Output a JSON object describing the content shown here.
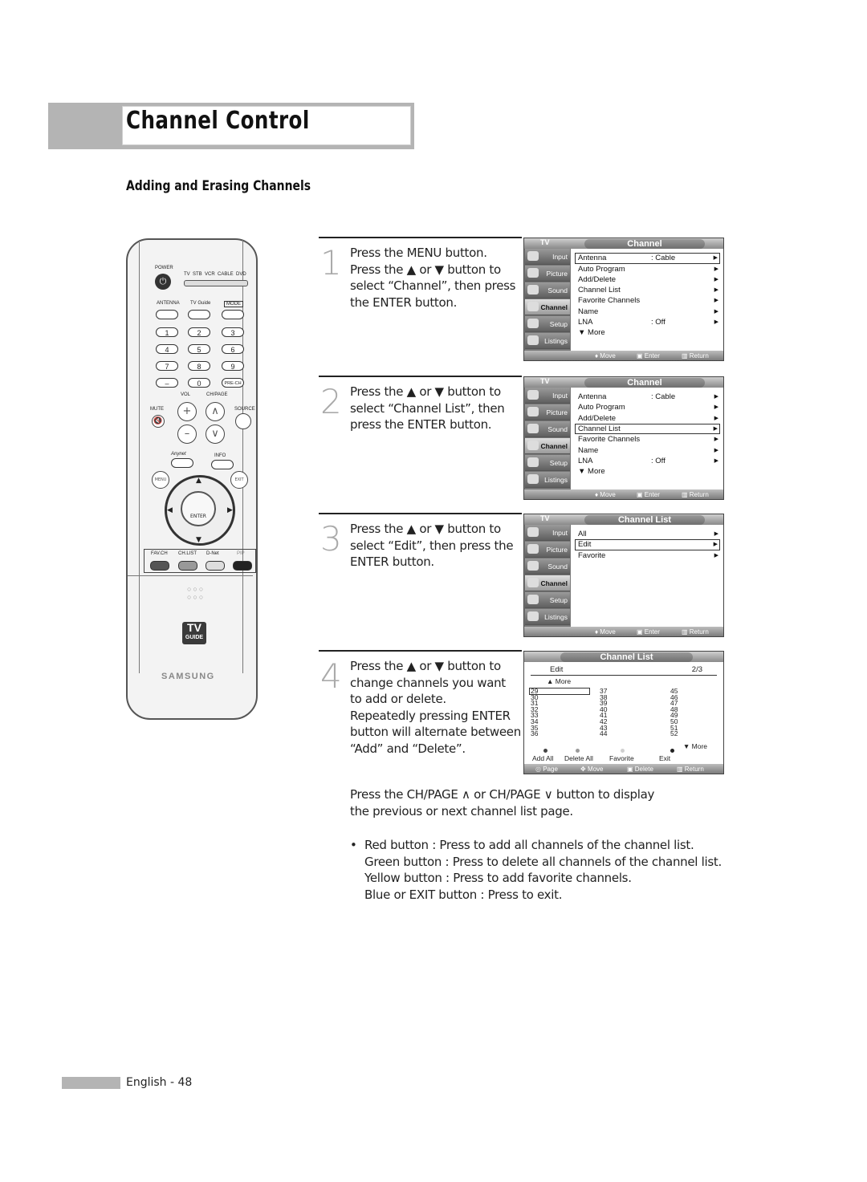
{
  "header": {
    "title": "Channel Control",
    "section": "Adding and Erasing Channels"
  },
  "remote": {
    "power_label": "POWER",
    "source_labels": "TV  STB  VCR  CABLE  DVD",
    "top_row": [
      "ANTENNA",
      "TV Guide",
      "MODE"
    ],
    "keypad": [
      "1",
      "2",
      "3",
      "4",
      "5",
      "6",
      "7",
      "8",
      "9",
      "–",
      "0",
      "PRE-CH"
    ],
    "vol_label": "VOL",
    "chpage_label": "CH/PAGE",
    "mute_label": "MUTE",
    "source_label": "SOURCE",
    "anynet_label": "Anynet",
    "info_label": "INFO",
    "menu_label": "MENU",
    "exit_label": "EXIT",
    "enter_label": "ENTER",
    "color_buttons": [
      "FAV.CH",
      "CH.LIST",
      "D-Net",
      "PIP"
    ],
    "tvguide_logo": [
      "TV",
      "GUIDE"
    ],
    "brand": "SAMSUNG"
  },
  "steps": [
    {
      "num": "1",
      "text": "Press the MENU button.\nPress the ▲ or ▼ button to\nselect “Channel”, then press\nthe ENTER button."
    },
    {
      "num": "2",
      "text": "Press the ▲ or ▼ button to\nselect “Channel List”, then\npress the ENTER button."
    },
    {
      "num": "3",
      "text": "Press the ▲ or ▼ button to\nselect “Edit”, then press the\nENTER button."
    },
    {
      "num": "4",
      "text": "Press the ▲ or ▼ button to\nchange channels you want\nto add or delete.\nRepeatedly pressing ENTER\nbutton will alternate between\n“Add” and “Delete”."
    }
  ],
  "osd_common": {
    "tv_label": "TV",
    "sidebar": [
      "Input",
      "Picture",
      "Sound",
      "Channel",
      "Setup",
      "Listings"
    ],
    "active_sidebar": "Channel",
    "footer": [
      "♦ Move",
      "Enter",
      "Return"
    ]
  },
  "osd1": {
    "title": "Channel",
    "rows": [
      {
        "label": "Antenna",
        "value": ": Cable",
        "arrow": "▶"
      },
      {
        "label": "Auto Program",
        "value": "",
        "arrow": "▶"
      },
      {
        "label": "Add/Delete",
        "value": "",
        "arrow": "▶"
      },
      {
        "label": "Channel List",
        "value": "",
        "arrow": "▶"
      },
      {
        "label": "Favorite Channels",
        "value": "",
        "arrow": "▶"
      },
      {
        "label": "Name",
        "value": "",
        "arrow": "▶"
      },
      {
        "label": "LNA",
        "value": ": Off",
        "arrow": "▶"
      },
      {
        "label": "▼ More",
        "value": "",
        "arrow": ""
      }
    ],
    "selected": "Antenna"
  },
  "osd2": {
    "title": "Channel",
    "selected": "Channel List"
  },
  "osd3": {
    "title": "Channel List",
    "rows": [
      {
        "label": "All",
        "arrow": "▶"
      },
      {
        "label": "Edit",
        "arrow": "▶"
      },
      {
        "label": "Favorite",
        "arrow": "▶"
      }
    ],
    "selected": "Edit"
  },
  "osd4": {
    "title": "Channel List",
    "mode": "Edit",
    "page": "2/3",
    "more_up": "▲ More",
    "more_down": "▼ More",
    "columns": [
      [
        "29",
        "30",
        "31",
        "32",
        "33",
        "34",
        "35",
        "36"
      ],
      [
        "37",
        "38",
        "39",
        "40",
        "41",
        "42",
        "43",
        "44"
      ],
      [
        "45",
        "46",
        "47",
        "48",
        "49",
        "50",
        "51",
        "52"
      ]
    ],
    "selected_channel": "29",
    "actions": [
      {
        "label": "Add All",
        "color": "#444444"
      },
      {
        "label": "Delete All",
        "color": "#9a9a9a"
      },
      {
        "label": "Favorite",
        "color": "#d0d0d0"
      },
      {
        "label": "Exit",
        "color": "#222222"
      }
    ],
    "footer": [
      "Page",
      "Move",
      "Delete",
      "Return"
    ]
  },
  "paragraph": "Press the CH/PAGE ∧ or CH/PAGE ∨ button to display\nthe previous or next channel list page.",
  "bullets": [
    "Red button : Press to add all channels of the channel list.",
    "Green button : Press to delete all channels of the channel list.",
    "Yellow button : Press to add favorite channels.",
    "Blue or EXIT button : Press to exit."
  ],
  "footer": {
    "page_label": "English - 48"
  }
}
